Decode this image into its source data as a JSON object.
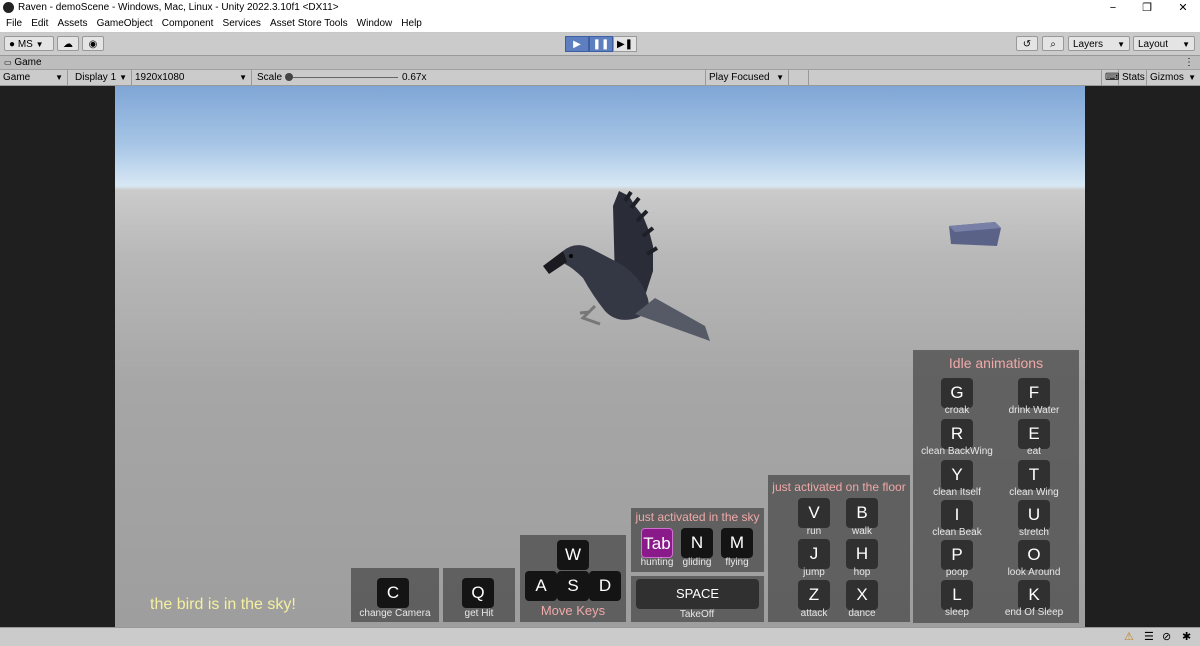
{
  "window": {
    "title": "Raven - demoScene - Windows, Mac, Linux - Unity 2022.3.10f1 <DX11>",
    "minimize": "−",
    "maximize": "❐",
    "close": "✕"
  },
  "menu": [
    "File",
    "Edit",
    "Assets",
    "GameObject",
    "Component",
    "Services",
    "Asset Store Tools",
    "Window",
    "Help"
  ],
  "toolbar": {
    "account": "MS",
    "play": "▶",
    "pause": "❚❚",
    "step": "▶❚",
    "layers": "Layers",
    "layout": "Layout"
  },
  "game_tab": {
    "label": "Game",
    "view": "Game",
    "display": "Display 1",
    "resolution": "1920x1080",
    "scale_label": "Scale",
    "scale_value": "0.67x",
    "scale_fraction": 0.12,
    "play_mode": "Play Focused",
    "stats": "Stats",
    "gizmos": "Gizmos"
  },
  "hud": {
    "status": "the bird is in the sky!",
    "camera": {
      "key": "C",
      "label": "change Camera"
    },
    "hit": {
      "key": "Q",
      "label": "get Hit"
    },
    "move": {
      "w": "W",
      "a": "A",
      "s": "S",
      "d": "D",
      "label": "Move Keys"
    },
    "sky": {
      "title": "just activated in the sky",
      "keys": [
        {
          "key": "Tab",
          "label": "hunting"
        },
        {
          "key": "N",
          "label": "gliding"
        },
        {
          "key": "M",
          "label": "flying"
        }
      ]
    },
    "space": {
      "key": "SPACE",
      "label": "TakeOff"
    },
    "floor": {
      "title": "just activated on the floor",
      "keys": [
        {
          "key": "V",
          "label": "run"
        },
        {
          "key": "B",
          "label": "walk"
        },
        {
          "key": "J",
          "label": "jump"
        },
        {
          "key": "H",
          "label": "hop"
        },
        {
          "key": "Z",
          "label": "attack"
        },
        {
          "key": "X",
          "label": "dance"
        }
      ]
    },
    "idle": {
      "title": "Idle animations",
      "keys": [
        {
          "key": "G",
          "label": "croak"
        },
        {
          "key": "F",
          "label": "drink Water"
        },
        {
          "key": "R",
          "label": "clean BackWing"
        },
        {
          "key": "E",
          "label": "eat"
        },
        {
          "key": "Y",
          "label": "clean Itself"
        },
        {
          "key": "T",
          "label": "clean Wing"
        },
        {
          "key": "I",
          "label": "clean Beak"
        },
        {
          "key": "U",
          "label": "stretch"
        },
        {
          "key": "P",
          "label": "poop"
        },
        {
          "key": "O",
          "label": "look Around"
        },
        {
          "key": "L",
          "label": "sleep"
        },
        {
          "key": "K",
          "label": "end Of Sleep"
        }
      ]
    }
  }
}
